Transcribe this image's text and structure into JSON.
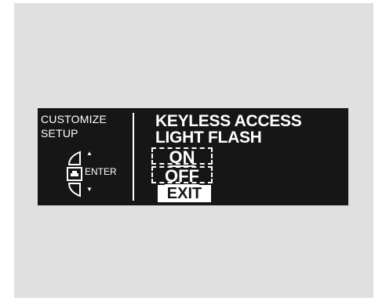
{
  "display": {
    "menu_title_line1": "CUSTOMIZE",
    "menu_title_line2": "SETUP",
    "enter_label": "ENTER",
    "setting_line1": "KEYLESS ACCESS",
    "setting_line2": "LIGHT FLASH",
    "options": [
      {
        "label": "ON"
      },
      {
        "label": "OFF"
      }
    ],
    "exit_label": "EXIT"
  },
  "colors": {
    "screen_background": "#161616",
    "panel_background": "#e0e0e0",
    "text": "#ffffff"
  }
}
